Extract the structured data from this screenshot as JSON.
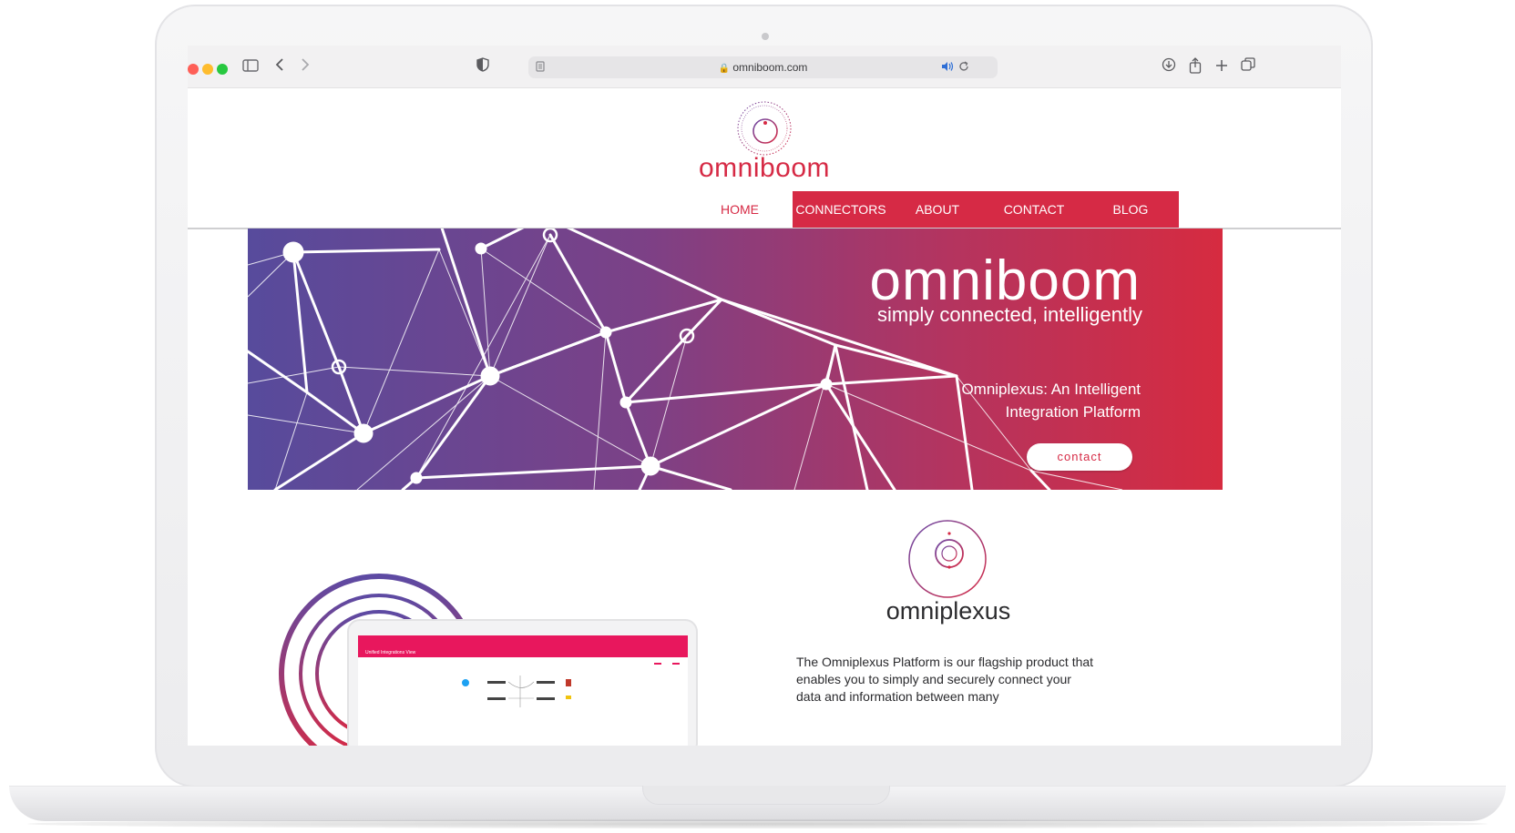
{
  "browser": {
    "url": "omniboom.com"
  },
  "site": {
    "brand": "omniboom",
    "nav": {
      "home": "HOME",
      "connectors": "CONNECTORS",
      "about": "ABOUT",
      "contact": "CONTACT",
      "blog": "BLOG"
    }
  },
  "hero": {
    "title": "omniboom",
    "subtitle": "simply connected, intelligently",
    "description_line1": "Omniplexus: An Intelligent",
    "description_line2": "Integration Platform",
    "button": "contact"
  },
  "product": {
    "name": "omniplexus",
    "description": "The Omniplexus Platform is our flagship product that enables you to simply and securely connect your data and information between many"
  },
  "mini_app": {
    "title": "Unified Integrations View"
  },
  "colors": {
    "brand_red": "#d62a45",
    "hero_start": "#574b9c",
    "hero_end": "#d62b40",
    "mini_app_bar": "#e8175d"
  }
}
